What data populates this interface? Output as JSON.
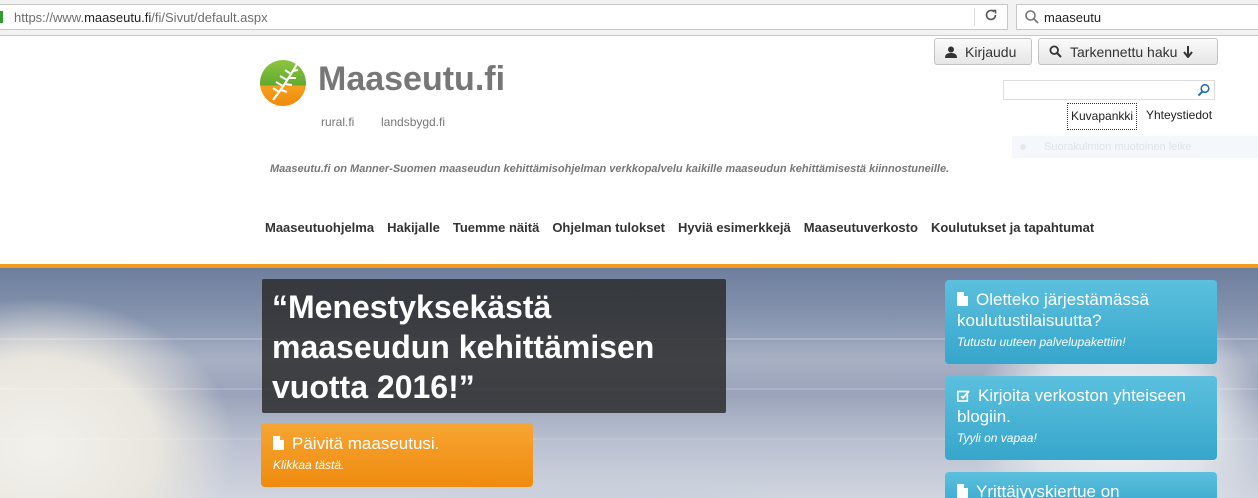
{
  "browser": {
    "url_prefix": "https://www.",
    "url_domain": "maaseutu.fi",
    "url_path": "/fi/Sivut/default.aspx",
    "search_query": "maaseutu"
  },
  "header": {
    "logo_text": "Maaseutu.fi",
    "sub_links": [
      "rural.fi",
      "landsbygd.fi"
    ],
    "tagline": "Maaseutu.fi on Manner-Suomen maaseudun kehittämisohjelman verkkopalvelu kaikille maaseudun kehittämisestä kiinnostuneille.",
    "login_label": "Kirjaudu",
    "advanced_search_label": "Tarkennettu haku",
    "site_search_value": "",
    "top_links": [
      "Kuvapankki",
      "Yhteystiedot"
    ],
    "ghost_text": "Suorakulmion muotoinen leike"
  },
  "nav": {
    "items": [
      "Maaseutuohjelma",
      "Hakijalle",
      "Tuemme näitä",
      "Ohjelman tulokset",
      "Hyviä esimerkkejä",
      "Maaseutuverkosto",
      "Koulutukset ja tapahtumat"
    ]
  },
  "hero": {
    "quote_lines": [
      "“Menestyksekästä",
      "maaseudun kehittämisen",
      "vuotta 2016!”"
    ],
    "orange_card": {
      "title": "Päivitä maaseutusi.",
      "subtitle": "Klikkaa tästä."
    },
    "blue_cards": [
      {
        "icon": "document-icon",
        "title": "Oletteko järjestämässä koulutustilaisuutta?",
        "subtitle": "Tutustu uuteen palvelupakettiin!"
      },
      {
        "icon": "edit-icon",
        "title": "Kirjoita verkoston yhteiseen blogiin.",
        "subtitle": "Tyyli on vapaa!"
      },
      {
        "icon": "document-icon",
        "title": "Yrittäjyyskiertue on",
        "subtitle": ""
      }
    ]
  },
  "colors": {
    "accent_orange": "#f29a1e",
    "card_blue": "#36a6cb",
    "text_gray": "#777777"
  }
}
